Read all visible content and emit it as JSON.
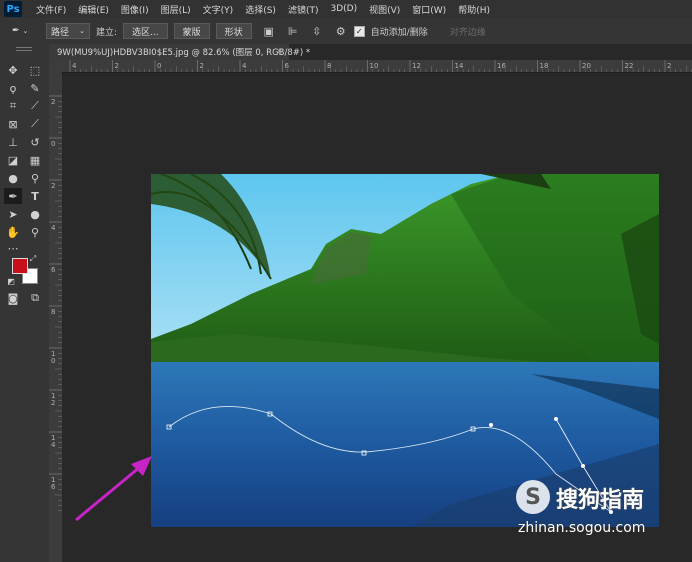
{
  "app": {
    "logo_text": "Ps"
  },
  "menu": [
    "文件(F)",
    "编辑(E)",
    "图像(I)",
    "图层(L)",
    "文字(Y)",
    "选择(S)",
    "滤镜(T)",
    "3D(D)",
    "视图(V)",
    "窗口(W)",
    "帮助(H)"
  ],
  "options": {
    "mode_value": "路径",
    "make_label": "建立:",
    "selection_button": "选区...",
    "mask_button": "蒙版",
    "shape_button": "形状",
    "auto_add_delete": "自动添加/删除",
    "align_edges": "对齐边缘"
  },
  "document": {
    "tab_title": "9W(MU9%UJ)HDBV3BI0$E5.jpg @ 82.6% (图层 0, RGB/8#) *",
    "close_glyph": "×"
  },
  "ruler_top_labels": [
    "4",
    "2",
    "0",
    "2",
    "4",
    "6",
    "8",
    "10",
    "12",
    "14",
    "16",
    "18",
    "20",
    "22",
    "2"
  ],
  "ruler_left_labels": [
    "2",
    "0",
    "2",
    "4",
    "6",
    "8",
    "1\n0",
    "1\n2",
    "1\n4",
    "1\n6"
  ],
  "watermark": {
    "logo": "S",
    "title": "搜狗指南",
    "url": "zhinan.sogou.com"
  },
  "colors": {
    "foreground": "#c8101a",
    "background": "#ffffff",
    "annotation_arrow": "#c724c7",
    "ps_blue": "#31a8ff"
  },
  "icons": [
    "move-icon",
    "marquee-icon",
    "lasso-icon",
    "quick-select-icon",
    "crop-icon",
    "eyedropper-icon",
    "frame-icon",
    "brush-icon",
    "stamp-icon",
    "history-brush-icon",
    "eraser-icon",
    "gradient-icon",
    "blur-icon",
    "dodge-icon",
    "pen-icon",
    "type-icon",
    "path-select-icon",
    "ellipse-icon",
    "hand-icon",
    "zoom-icon",
    "more-icon",
    "quickmask-icon",
    "screen-mode-icon"
  ]
}
